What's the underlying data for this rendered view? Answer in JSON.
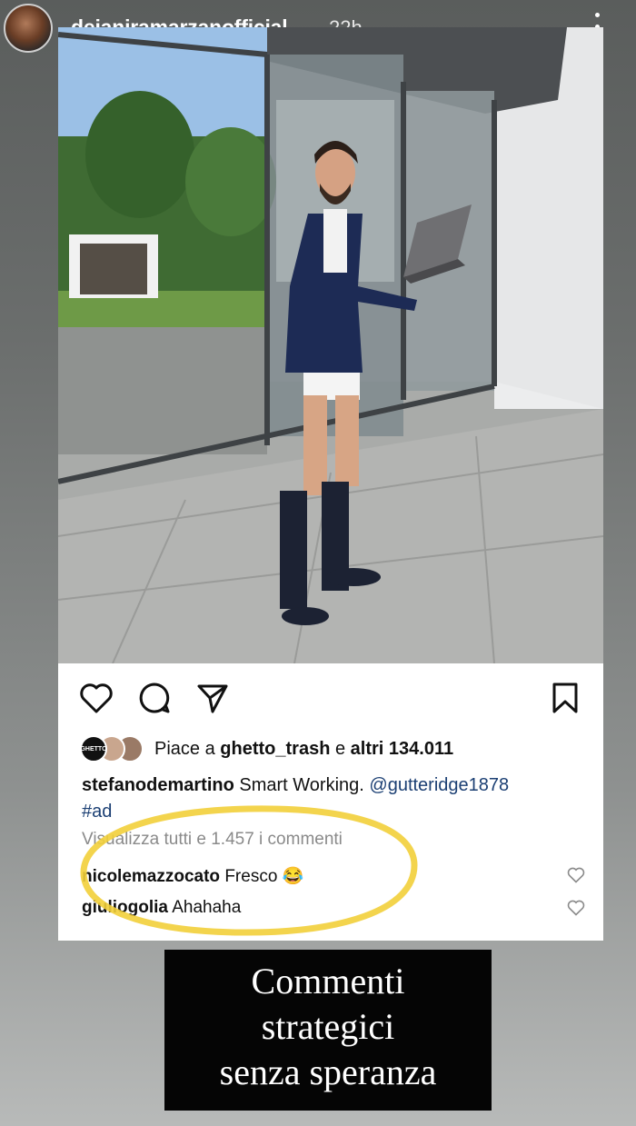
{
  "story": {
    "username": "deianiramarzanofficial",
    "time": "22h"
  },
  "post": {
    "likes_prefix": "Piace a",
    "likes_user": "ghetto_trash",
    "likes_middle": "e",
    "likes_count": "altri 134.011",
    "liker_avatar_label": "GHETTO",
    "caption_user": "stefanodemartino",
    "caption_text": "Smart Working.",
    "caption_mention": "@gutteridge1878",
    "caption_hashtag": "#ad",
    "view_all_comments": "Visualizza tutti e 1.457 i commenti",
    "comments": [
      {
        "user": "nicolemazzocato",
        "text": "Fresco 😂"
      },
      {
        "user": "giuliogolia",
        "text": "Ahahaha"
      }
    ]
  },
  "sticker": {
    "line1": "Commenti",
    "line2": "strategici",
    "line3": "senza speranza"
  },
  "colors": {
    "highlight": "#f2cf3a",
    "sticker_bg": "#050505",
    "link": "#1b3f73"
  }
}
